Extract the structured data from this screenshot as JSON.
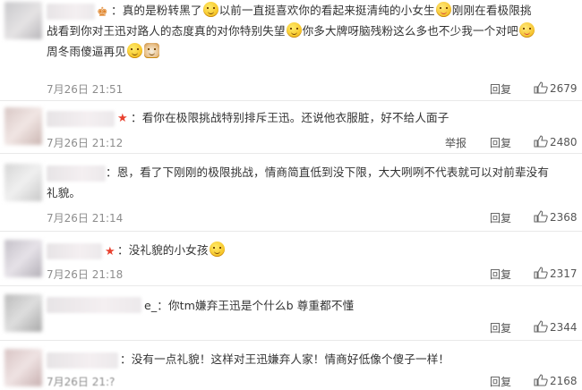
{
  "colors": {
    "text": "#333333",
    "time": "#8d8d8d",
    "action": "#555555",
    "star": "#e8412f",
    "divider": "#e9e9e9"
  },
  "comments": [
    {
      "lines": [
        [
          {
            "t": "："
          },
          {
            "t": "真的是粉转黑了"
          },
          {
            "icon": "smile"
          },
          {
            "t": "以前一直挺喜欢你的看起来挺清纯的小女生"
          },
          {
            "icon": "shy"
          },
          {
            "t": "刚刚在看极限挑"
          }
        ],
        [
          {
            "t": "战看到你对王迅对路人的态度真的对你特别失望"
          },
          {
            "icon": "smile"
          },
          {
            "t": "你多大牌呀脑残粉这么多也不少我一个对吧"
          },
          {
            "icon": "shy"
          }
        ],
        [
          {
            "t": "周冬雨傻逼再见"
          },
          {
            "icon": "smile"
          },
          {
            "icon": "dog"
          }
        ]
      ],
      "time": "7月26日 21:51",
      "actions": [
        "回复"
      ],
      "likes": "2679"
    },
    {
      "lines": [
        [
          {
            "t": "：看你在极限挑战特别排斥王迅。还说他衣服脏，好不给人面子"
          }
        ]
      ],
      "time": "7月26日 21:12",
      "actions": [
        "举报",
        "回复"
      ],
      "likes": "2480"
    },
    {
      "lines": [
        [
          {
            "t": "：恩，看了下刚刚的极限挑战，情商简直低到没下限，大大咧咧不代表就可以对前辈没有"
          }
        ],
        [
          {
            "t": "礼貌。"
          }
        ]
      ],
      "time": "7月26日 21:14",
      "actions": [
        "回复"
      ],
      "likes": "2368"
    },
    {
      "lines": [
        [
          {
            "t": "：没礼貌的小女孩"
          },
          {
            "icon": "smile"
          }
        ]
      ],
      "time": "7月26日 21:18",
      "actions": [
        "回复"
      ],
      "likes": "2317"
    },
    {
      "lines": [
        [
          {
            "t": "e_：你tm嫌弃王迅是个什么b 尊重都不懂"
          }
        ]
      ],
      "time": "",
      "actions": [
        "回复"
      ],
      "likes": "2344"
    },
    {
      "lines": [
        [
          {
            "t": "：没有一点礼貌！这样对王迅嫌弃人家！情商好低像个傻子一样！"
          }
        ]
      ],
      "time": "7月26日 21:?",
      "actions": [
        "回复"
      ],
      "likes": "2168"
    }
  ]
}
